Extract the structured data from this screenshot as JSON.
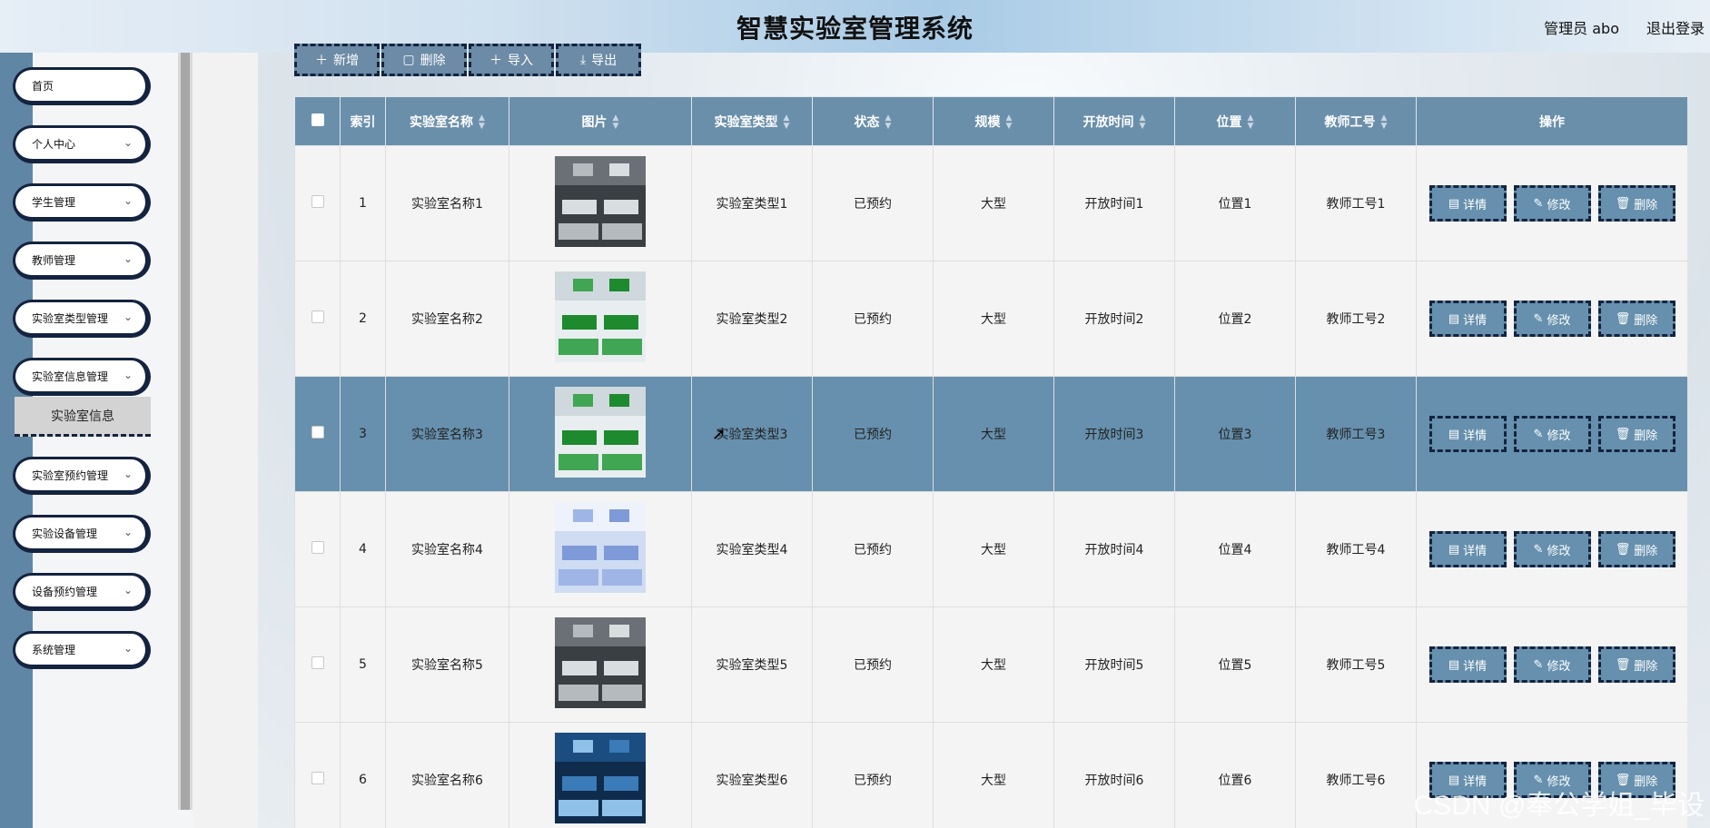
{
  "header": {
    "title": "智慧实验室管理系统",
    "user": "管理员 abo",
    "logout": "退出登录"
  },
  "sidebar": {
    "items": [
      {
        "label": "首页",
        "chevron": false
      },
      {
        "label": "个人中心",
        "chevron": true
      },
      {
        "label": "学生管理",
        "chevron": true
      },
      {
        "label": "教师管理",
        "chevron": true
      },
      {
        "label": "实验室类型管理",
        "chevron": true
      },
      {
        "label": "实验室信息管理",
        "chevron": true
      },
      {
        "label": "实验室预约管理",
        "chevron": true
      },
      {
        "label": "实验设备管理",
        "chevron": true
      },
      {
        "label": "设备预约管理",
        "chevron": true
      },
      {
        "label": "系统管理",
        "chevron": true
      }
    ],
    "submenu_active": "实验室信息"
  },
  "toolbar": {
    "add": "新增",
    "delete": "删除",
    "import": "导入",
    "export": "导出"
  },
  "table": {
    "headers": [
      "索引",
      "实验室名称",
      "图片",
      "实验室类型",
      "状态",
      "规模",
      "开放时间",
      "位置",
      "教师工号",
      "操作"
    ],
    "ops": {
      "detail": "详情",
      "edit": "修改",
      "delete": "删除"
    },
    "rows": [
      {
        "index": "1",
        "name": "实验室名称1",
        "type": "实验室类型1",
        "status": "已预约",
        "scale": "大型",
        "open": "开放时间1",
        "location": "位置1",
        "teacher": "教师工号1",
        "image": "lab-photo-dark"
      },
      {
        "index": "2",
        "name": "实验室名称2",
        "type": "实验室类型2",
        "status": "已预约",
        "scale": "大型",
        "open": "开放时间2",
        "location": "位置2",
        "teacher": "教师工号2",
        "image": "lab-photo-green"
      },
      {
        "index": "3",
        "name": "实验室名称3",
        "type": "实验室类型3",
        "status": "已预约",
        "scale": "大型",
        "open": "开放时间3",
        "location": "位置3",
        "teacher": "教师工号3",
        "image": "lab-photo-green"
      },
      {
        "index": "4",
        "name": "实验室名称4",
        "type": "实验室类型4",
        "status": "已预约",
        "scale": "大型",
        "open": "开放时间4",
        "location": "位置4",
        "teacher": "教师工号4",
        "image": "lab-photo-blue"
      },
      {
        "index": "5",
        "name": "实验室名称5",
        "type": "实验室类型5",
        "status": "已预约",
        "scale": "大型",
        "open": "开放时间5",
        "location": "位置5",
        "teacher": "教师工号5",
        "image": "lab-photo-dark"
      },
      {
        "index": "6",
        "name": "实验室名称6",
        "type": "实验室类型6",
        "status": "已预约",
        "scale": "大型",
        "open": "开放时间6",
        "location": "位置6",
        "teacher": "教师工号6",
        "image": "lab-photo-navy"
      }
    ],
    "selected_row": 2
  },
  "watermark": "CSDN @奉公学姐_毕设",
  "colors": {
    "accent": "#6690ad",
    "rail": "#5f86a4",
    "border": "#14233f"
  }
}
